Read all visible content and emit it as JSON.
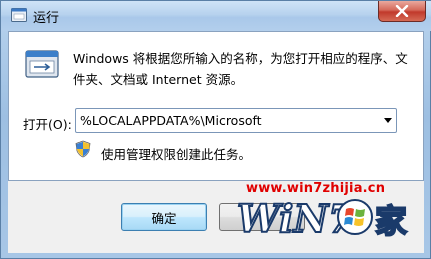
{
  "window": {
    "title": "运行",
    "close_label": "×"
  },
  "dialog": {
    "description": "Windows 将根据您所输入的名称，为您打开相应的程序、文件夹、文档或 Internet 资源。",
    "open_label": "打开(O):",
    "open_value": "%LOCALAPPDATA%\\Microsoft",
    "admin_note": "使用管理权限创建此任务。"
  },
  "buttons": {
    "ok_label": "确定"
  },
  "watermark": {
    "url": "www.win7zhijia.cn",
    "logo_text": "WiN7",
    "logo_char": "家"
  },
  "colors": {
    "close_red": "#c1392b",
    "watermark_red": "#e00000",
    "ok_border": "#3c7fb1"
  },
  "icons": {
    "title": "run-icon",
    "dialog": "run-icon",
    "shield": "uac-shield-icon",
    "dropdown": "chevron-down-icon",
    "close": "close-icon",
    "flag": "windows-flag-icon"
  }
}
